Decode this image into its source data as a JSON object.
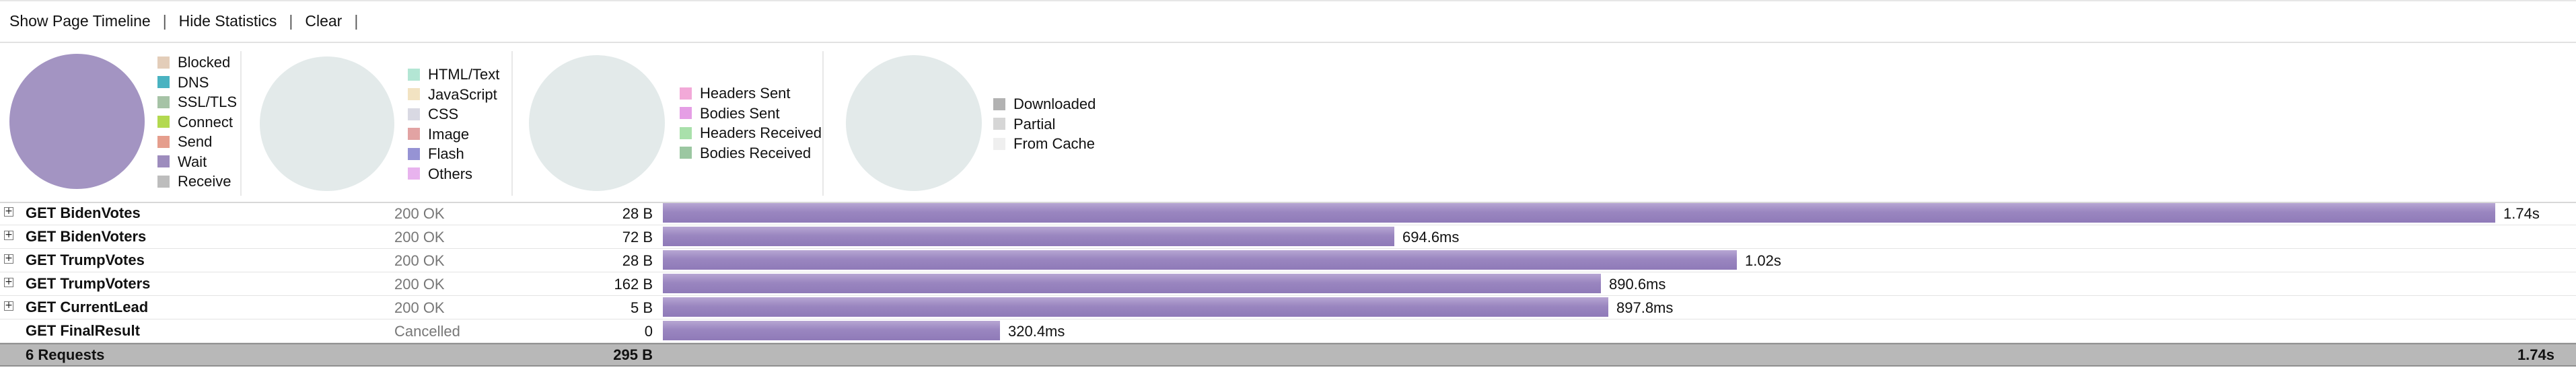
{
  "toolbar": {
    "show_timeline": "Show Page Timeline",
    "hide_statistics": "Hide Statistics",
    "clear": "Clear",
    "separator": "|"
  },
  "stats": {
    "timings_legend": [
      {
        "label": "Blocked",
        "color": "#e3cdb9"
      },
      {
        "label": "DNS",
        "color": "#49b3c1"
      },
      {
        "label": "SSL/TLS",
        "color": "#a6c3a6"
      },
      {
        "label": "Connect",
        "color": "#b3d94f"
      },
      {
        "label": "Send",
        "color": "#e59e8d"
      },
      {
        "label": "Wait",
        "color": "#9d8cbd"
      },
      {
        "label": "Receive",
        "color": "#bdbdbd"
      }
    ],
    "types_legend": [
      {
        "label": "HTML/Text",
        "color": "#b3e6d4"
      },
      {
        "label": "JavaScript",
        "color": "#f2e3c2"
      },
      {
        "label": "CSS",
        "color": "#d9d9e3"
      },
      {
        "label": "Image",
        "color": "#e2a3a3"
      },
      {
        "label": "Flash",
        "color": "#9693d4"
      },
      {
        "label": "Others",
        "color": "#e8b3ee"
      }
    ],
    "traffic_legend": [
      {
        "label": "Headers Sent",
        "color": "#f2a9d8"
      },
      {
        "label": "Bodies Sent",
        "color": "#e59ee5"
      },
      {
        "label": "Headers Received",
        "color": "#a9e0ab"
      },
      {
        "label": "Bodies Received",
        "color": "#9bc7a1"
      }
    ],
    "cache_legend": [
      {
        "label": "Downloaded",
        "color": "#b2b2b2"
      },
      {
        "label": "Partial",
        "color": "#d6d6d6"
      },
      {
        "label": "From Cache",
        "color": "#efefef"
      }
    ],
    "pie_main_color": "#a394c2",
    "pie_empty_color": "#e3eaea"
  },
  "requests": [
    {
      "name": "GET BidenVotes",
      "status": "200 OK",
      "size": "28 B",
      "time": "1.74s",
      "fraction": 1.0,
      "expandable": true
    },
    {
      "name": "GET BidenVoters",
      "status": "200 OK",
      "size": "72 B",
      "time": "694.6ms",
      "fraction": 0.3992,
      "expandable": true
    },
    {
      "name": "GET TrumpVotes",
      "status": "200 OK",
      "size": "28 B",
      "time": "1.02s",
      "fraction": 0.5862,
      "expandable": true
    },
    {
      "name": "GET TrumpVoters",
      "status": "200 OK",
      "size": "162 B",
      "time": "890.6ms",
      "fraction": 0.5118,
      "expandable": true
    },
    {
      "name": "GET CurrentLead",
      "status": "200 OK",
      "size": "5 B",
      "time": "897.8ms",
      "fraction": 0.516,
      "expandable": true
    },
    {
      "name": "GET FinalResult",
      "status": "Cancelled",
      "size": "0",
      "time": "320.4ms",
      "fraction": 0.1841,
      "expandable": false
    }
  ],
  "summary": {
    "count": "6 Requests",
    "size": "295 B",
    "time": "1.74s"
  }
}
